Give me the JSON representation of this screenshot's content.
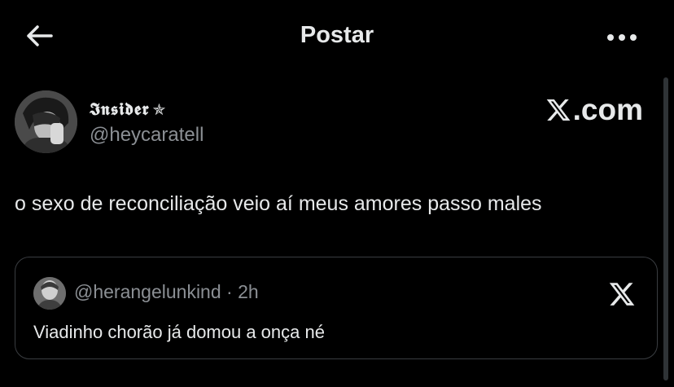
{
  "header": {
    "title": "Postar",
    "back_icon": "arrow-left-icon",
    "more_icon": "more-horizontal-icon"
  },
  "author": {
    "display_name": "𝕴𝖓𝖘𝖎𝖉𝖊𝖗",
    "star": "✯",
    "handle": "@heycaratell",
    "avatar_icon": "avatar-image"
  },
  "brand": {
    "suffix": ".com",
    "logo_icon": "x-logo-icon"
  },
  "post": {
    "text": "o sexo de reconciliação veio aí meus amores passo males"
  },
  "quote": {
    "handle": "@herangelunkind",
    "separator": "·",
    "time": "2h",
    "text": "Viadinho chorão já domou a onça né",
    "logo_icon": "x-logo-icon"
  },
  "colors": {
    "background": "#000000",
    "text": "#e7e9ea",
    "secondary": "#8b8f94",
    "border": "#3a3d41"
  }
}
